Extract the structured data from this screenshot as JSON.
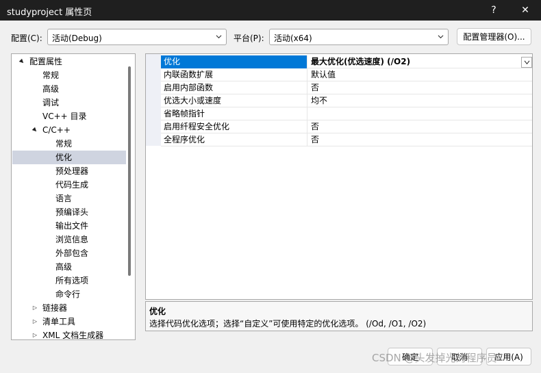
{
  "window": {
    "title": "studyproject 属性页",
    "help_label": "?",
    "close_label": "✕"
  },
  "config_bar": {
    "config_label": "配置(C):",
    "config_value": "活动(Debug)",
    "platform_label": "平台(P):",
    "platform_value": "活动(x64)",
    "manager_button": "配置管理器(O)..."
  },
  "tree": [
    {
      "label": "配置属性",
      "indent": 0,
      "expander": "▲",
      "selected": false
    },
    {
      "label": "常规",
      "indent": 1,
      "expander": "",
      "selected": false
    },
    {
      "label": "高级",
      "indent": 1,
      "expander": "",
      "selected": false
    },
    {
      "label": "调试",
      "indent": 1,
      "expander": "",
      "selected": false
    },
    {
      "label": "VC++ 目录",
      "indent": 1,
      "expander": "",
      "selected": false
    },
    {
      "label": "C/C++",
      "indent": 1,
      "expander": "▲",
      "selected": false
    },
    {
      "label": "常规",
      "indent": 2,
      "expander": "",
      "selected": false
    },
    {
      "label": "优化",
      "indent": 2,
      "expander": "",
      "selected": true
    },
    {
      "label": "预处理器",
      "indent": 2,
      "expander": "",
      "selected": false
    },
    {
      "label": "代码生成",
      "indent": 2,
      "expander": "",
      "selected": false
    },
    {
      "label": "语言",
      "indent": 2,
      "expander": "",
      "selected": false
    },
    {
      "label": "预编译头",
      "indent": 2,
      "expander": "",
      "selected": false
    },
    {
      "label": "输出文件",
      "indent": 2,
      "expander": "",
      "selected": false
    },
    {
      "label": "浏览信息",
      "indent": 2,
      "expander": "",
      "selected": false
    },
    {
      "label": "外部包含",
      "indent": 2,
      "expander": "",
      "selected": false
    },
    {
      "label": "高级",
      "indent": 2,
      "expander": "",
      "selected": false
    },
    {
      "label": "所有选项",
      "indent": 2,
      "expander": "",
      "selected": false
    },
    {
      "label": "命令行",
      "indent": 2,
      "expander": "",
      "selected": false
    },
    {
      "label": "链接器",
      "indent": 1,
      "expander": "▷",
      "selected": false
    },
    {
      "label": "清单工具",
      "indent": 1,
      "expander": "▷",
      "selected": false
    },
    {
      "label": "XML 文档生成器",
      "indent": 1,
      "expander": "▷",
      "selected": false
    }
  ],
  "properties": [
    {
      "name": "优化",
      "value": "最大优化(优选速度) (/O2)",
      "selected": true
    },
    {
      "name": "内联函数扩展",
      "value": "默认值",
      "selected": false
    },
    {
      "name": "启用内部函数",
      "value": "否",
      "selected": false
    },
    {
      "name": "优选大小或速度",
      "value": "均不",
      "selected": false
    },
    {
      "name": "省略帧指针",
      "value": "",
      "selected": false
    },
    {
      "name": "启用纤程安全优化",
      "value": "否",
      "selected": false
    },
    {
      "name": "全程序优化",
      "value": "否",
      "selected": false
    }
  ],
  "description": {
    "title": "优化",
    "text": "选择代码优化选项；选择“自定义”可使用特定的优化选项。     (/Od, /O1, /O2)"
  },
  "footer": {
    "ok_button": "确定",
    "cancel_button": "取消",
    "apply_button": "应用(A)"
  },
  "watermark": "CSDN @头发掉光的程序员",
  "colors": {
    "titlebar": "#1f1f1f",
    "selection_accent": "#0078d7",
    "tree_selection": "#cfd4e0"
  }
}
